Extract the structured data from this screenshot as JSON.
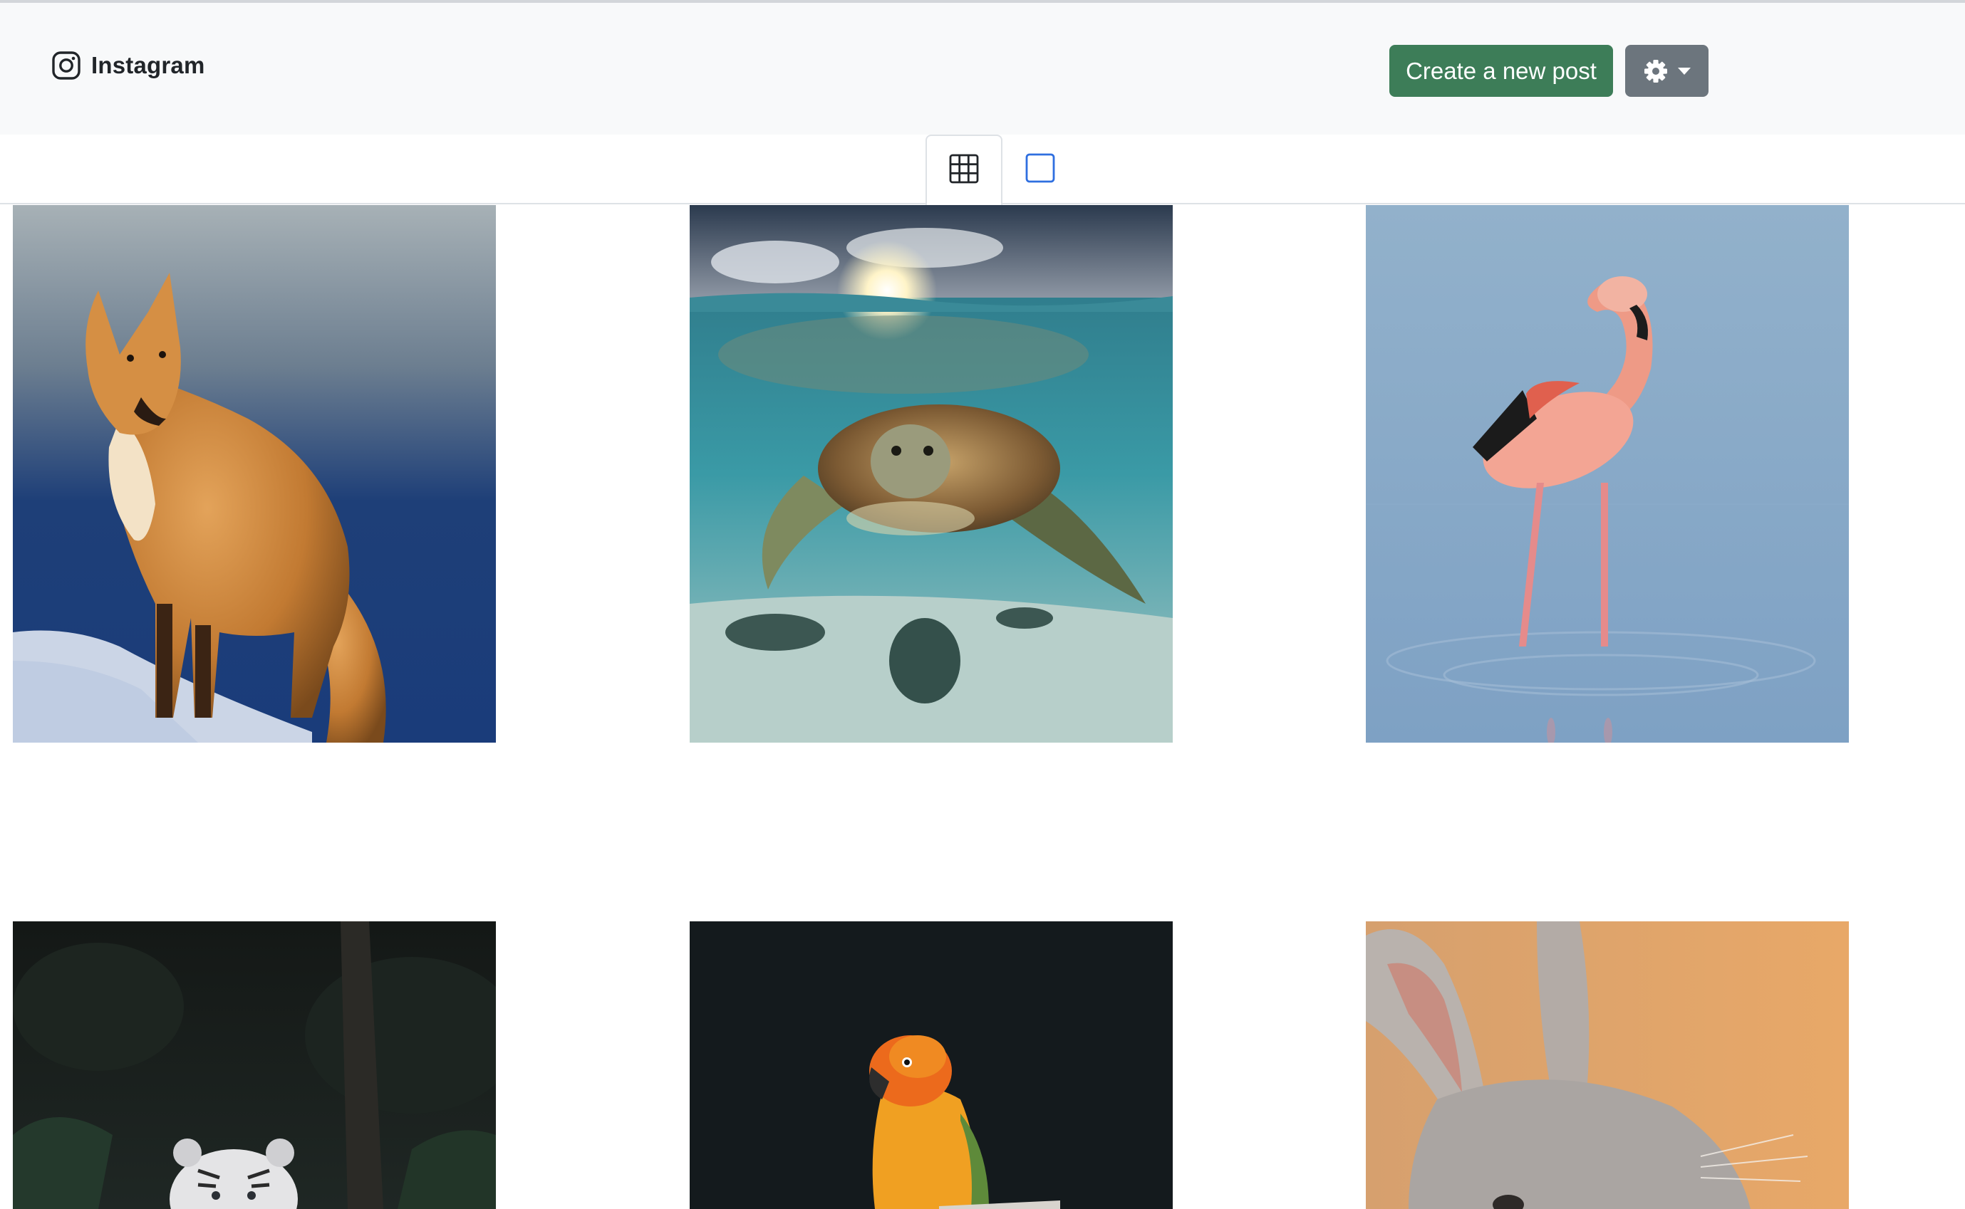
{
  "app": {
    "brand": "Instagram",
    "brand_icon": "instagram-icon"
  },
  "navbar": {
    "create_label": "Create a new post",
    "settings_icon": "gear-icon",
    "dropdown_icon": "caret-down-icon"
  },
  "view_toggle": {
    "active": "grid",
    "tabs": [
      {
        "icon": "grid-icon",
        "view": "grid"
      },
      {
        "icon": "square-icon",
        "view": "single"
      }
    ]
  },
  "posts": [
    {
      "subject": "fox"
    },
    {
      "subject": "sea turtle"
    },
    {
      "subject": "flamingo"
    },
    {
      "subject": "white tiger"
    },
    {
      "subject": "parrot"
    },
    {
      "subject": "rabbit"
    }
  ],
  "colors": {
    "create_button": "#3d7d58",
    "settings_button": "#6c757d",
    "active_tab_icon": "#0d6efd",
    "navbar_bg": "#f8f9fa"
  }
}
